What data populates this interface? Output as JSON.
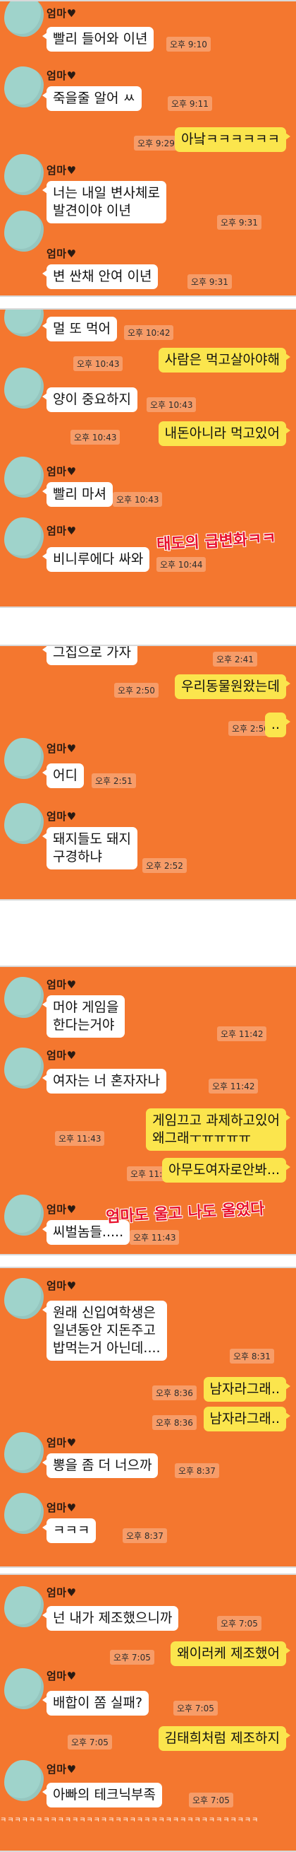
{
  "contact_name": "엄마♥",
  "colors": {
    "background": "#f4772f",
    "incoming_bubble": "#ffffff",
    "outgoing_bubble": "#fbe54d",
    "caption": "#e8112d",
    "avatar": "#9fd3cb"
  },
  "panel1": {
    "m1": {
      "text": "빨리 들어와 이년",
      "time": "오후 9:10"
    },
    "m2": {
      "text": "죽을줄 알어  ㅆ",
      "time": "오후 9:11"
    },
    "m3": {
      "text": "아낰ㅋㅋㅋㅋㅋㅋ",
      "time": "오후 9:29"
    },
    "m4": {
      "line1": "너는 내일 변사체로",
      "line2": "발견이야 이년",
      "time": "오후 9:31"
    },
    "m5": {
      "text": "변 싼채  안여 이년",
      "time": "오후 9:31"
    }
  },
  "panel2": {
    "m1": {
      "text": "멀 또 먹어",
      "time": "오후 10:42"
    },
    "m2": {
      "text": "사람은 먹고살아야해",
      "time": "오후 10:43"
    },
    "m3": {
      "text": "양이 중요하지",
      "time": "오후 10:43"
    },
    "m4": {
      "text": "내돈아니라 먹고있어",
      "time": "오후 10:43"
    },
    "m5": {
      "text": "빨리 마셔",
      "time": "오후 10:43"
    },
    "m6": {
      "text": "비니루에다  싸와",
      "time": "오후 10:44"
    },
    "caption": "태도의 급변화ㅋㅋ"
  },
  "panel3": {
    "m1": {
      "text": "그집으로 가자",
      "time": "오후 2:41"
    },
    "m2": {
      "text": "우리동물원왔는데",
      "time": "오후 2:50"
    },
    "m3": {
      "text": "..",
      "time": "오후 2:50"
    },
    "m4": {
      "text": "어디",
      "time": "오후 2:51"
    },
    "m5": {
      "line1": "돼지들도 돼지",
      "line2": "구경하냐",
      "time": "오후 2:52"
    }
  },
  "panel4": {
    "m1": {
      "line1": "머야 게임을",
      "line2": "한다는거야",
      "time": "오후 11:42"
    },
    "m2": {
      "text": "여자는 너 혼자자나",
      "time": "오후 11:42"
    },
    "m3": {
      "line1": "게임끄고 과제하고있어",
      "line2": "왜그래ㅜㅠㅠㅠㅠ",
      "time": "오후 11:43"
    },
    "m4": {
      "text": "아무도여자로안봐...",
      "time": "오후 11:43"
    },
    "m5": {
      "text": "씨벌놈들.....",
      "time": "오후 11:43"
    },
    "caption": "엄마도 울고 나도 울었다"
  },
  "panel5": {
    "m1": {
      "line1": "원래 신입여학생은",
      "line2": "일년동안 지돈주고",
      "line3": "밥먹는거 아닌데....",
      "time": "오후 8:31"
    },
    "m2": {
      "text": "남자라그래..",
      "time": "오후 8:36"
    },
    "m3": {
      "text": "남자라그래..",
      "time": "오후 8:36"
    },
    "m4": {
      "text": "뽕을 좀 더 너으까",
      "time": "오후 8:37"
    },
    "m5": {
      "text": "ㅋㅋㅋ",
      "time": "오후 8:37"
    }
  },
  "panel6": {
    "m1": {
      "text": "넌 내가 제조했으니까",
      "time": "오후 7:05"
    },
    "m2": {
      "text": "왜이러케 제조했어",
      "time": "오후 7:05"
    },
    "m3": {
      "text": "배합이 쫌 실패?",
      "time": "오후 7:05"
    },
    "m4": {
      "text": "김태희처럼 제조하지",
      "time": "오후 7:05"
    },
    "m5": {
      "text": "아빠의 테크닉부족",
      "time": "오후 7:05"
    }
  },
  "footer_strip": "ㅋㅋㅋㅋㅋㅋㅋㅋㅋㅋㅋㅋㅋㅋㅋㅋㅋㅋㅋㅋㅋㅋㅋㅋㅋㅋㅋㅋㅋㅋㅋㅋㅋㅋㅋㅋ"
}
